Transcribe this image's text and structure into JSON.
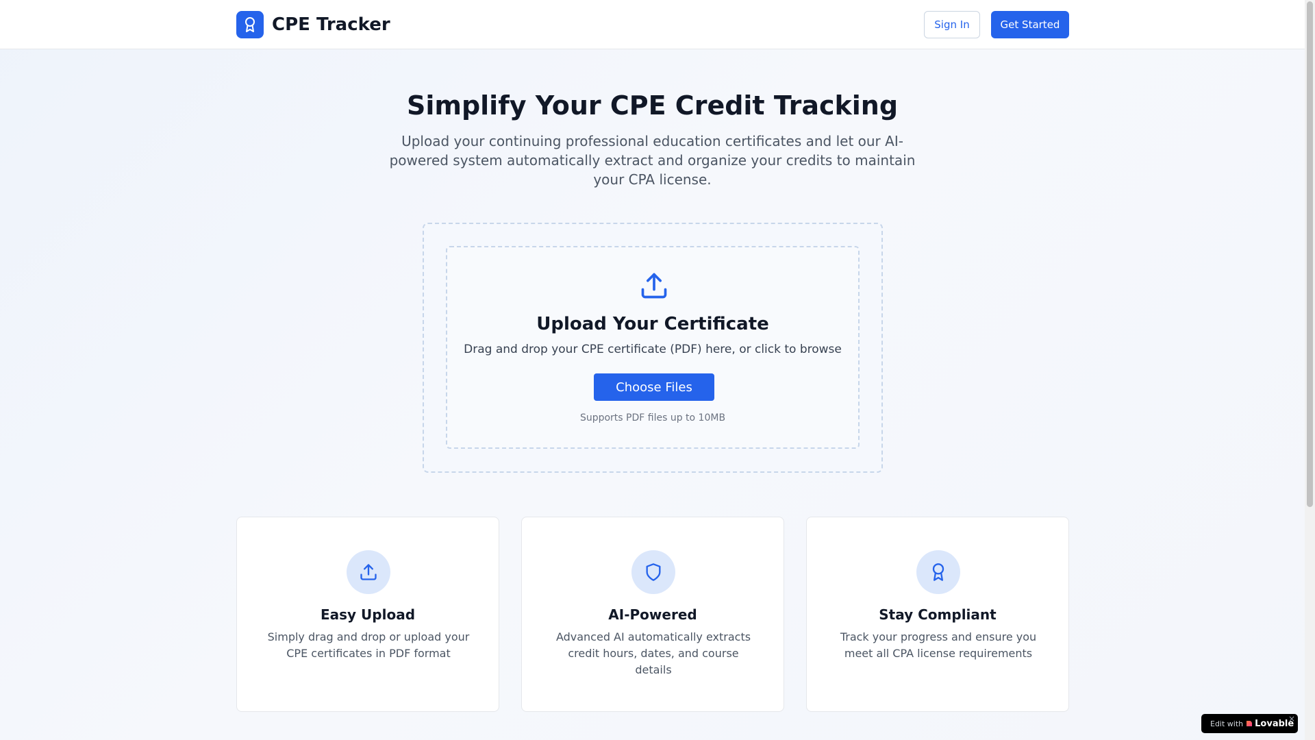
{
  "header": {
    "brand_name": "CPE Tracker",
    "sign_in_label": "Sign In",
    "get_started_label": "Get Started"
  },
  "hero": {
    "title": "Simplify Your CPE Credit Tracking",
    "subtitle": "Upload your continuing professional education certificates and let our AI-powered system automatically extract and organize your credits to maintain your CPA license."
  },
  "upload": {
    "title": "Upload Your Certificate",
    "description": "Drag and drop your CPE certificate (PDF) here, or click to browse",
    "button_label": "Choose Files",
    "note": "Supports PDF files up to 10MB"
  },
  "features": [
    {
      "icon": "upload-icon",
      "title": "Easy Upload",
      "description": "Simply drag and drop or upload your CPE certificates in PDF format"
    },
    {
      "icon": "shield-icon",
      "title": "AI-Powered",
      "description": "Advanced AI automatically extracts credit hours, dates, and course details"
    },
    {
      "icon": "award-icon",
      "title": "Stay Compliant",
      "description": "Track your progress and ensure you meet all CPA license requirements"
    }
  ],
  "badge": {
    "prefix": "Edit with",
    "brand": "Lovable",
    "close": "×"
  },
  "colors": {
    "primary": "#2563eb",
    "icon_circle": "#dbe7fb",
    "text_dark": "#111827",
    "text_muted": "#4b5563"
  }
}
